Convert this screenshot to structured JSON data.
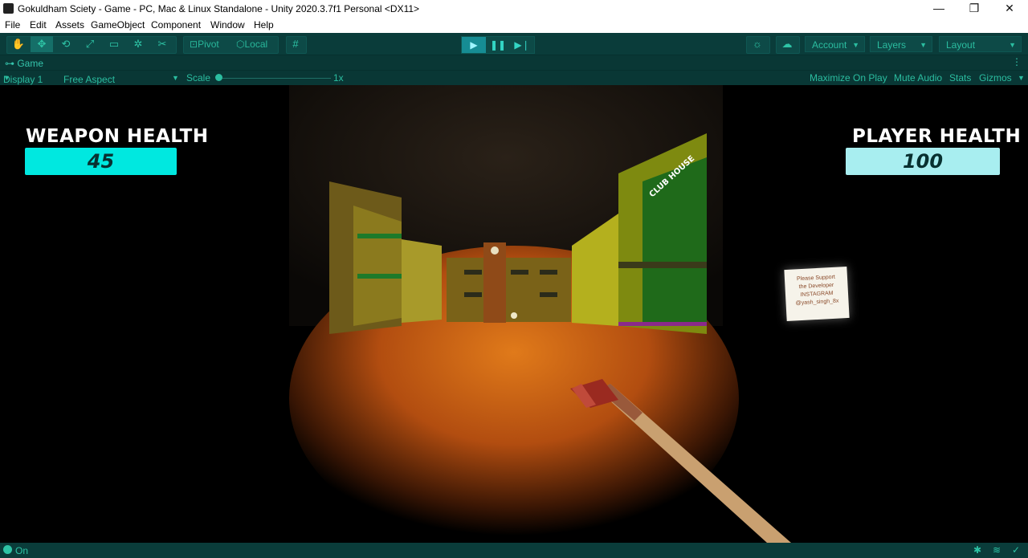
{
  "window": {
    "title": "Gokuldham Sciety - Game - PC, Mac & Linux Standalone - Unity 2020.3.7f1 Personal <DX11>",
    "minimize": "—",
    "restore": "❐",
    "close": "✕"
  },
  "menu": [
    "File",
    "Edit",
    "Assets",
    "GameObject",
    "Component",
    "Window",
    "Help"
  ],
  "toolbar": {
    "pivot_label": "Pivot",
    "local_label": "Local",
    "account_label": "Account",
    "layers_label": "Layers",
    "layout_label": "Layout"
  },
  "game_tab": {
    "label": "Game"
  },
  "game_bar": {
    "display": "Display 1",
    "aspect": "Free Aspect",
    "scale_label": "Scale",
    "scale_value": "1x",
    "maximize_on_play": "Maximize On Play",
    "mute_audio": "Mute Audio",
    "stats": "Stats",
    "gizmos": "Gizmos"
  },
  "hud": {
    "weapon_health_label": "WEAPON HEALTH",
    "weapon_health_value": "45",
    "player_health_label": "PLAYER HEALTH",
    "player_health_value": "100",
    "club_house_sign": "CLUB HOUSE",
    "note_lines": [
      "Please Support",
      "the Developer",
      "INSTAGRAM",
      "@yash_singh_8x"
    ]
  },
  "status": {
    "text": "On"
  },
  "colors": {
    "editor_bg": "#0a3c3a",
    "accent": "#2ec4a6",
    "weapon_bar": "#00e8e0",
    "player_bar": "#a8eef0"
  }
}
